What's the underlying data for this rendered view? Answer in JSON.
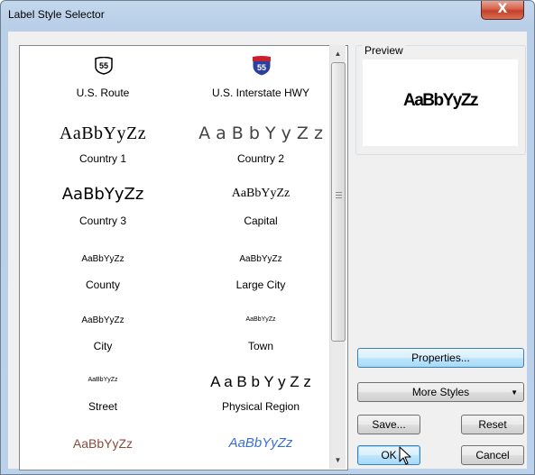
{
  "window": {
    "title": "Label Style Selector",
    "close_glyph": "X"
  },
  "styles": [
    {
      "sample": "55",
      "caption": "U.S. Route",
      "kind": "us-route-shield"
    },
    {
      "sample": "55",
      "caption": "U.S. Interstate HWY",
      "kind": "interstate-shield"
    },
    {
      "sample": "AaBbYyZz",
      "caption": "Country 1"
    },
    {
      "sample": "A a B b Y y Z z",
      "caption": "Country 2"
    },
    {
      "sample": "AaBbYyZz",
      "caption": "Country 3"
    },
    {
      "sample": "AaBbYyZz",
      "caption": "Capital"
    },
    {
      "sample": "AaBbYyZz",
      "caption": "County"
    },
    {
      "sample": "AaBbYyZz",
      "caption": "Large City"
    },
    {
      "sample": "AaBbYyZz",
      "caption": "City"
    },
    {
      "sample": "AaBbYyZz",
      "caption": "Town"
    },
    {
      "sample": "AaBbYyZz",
      "caption": "Street"
    },
    {
      "sample": "A a B b Y y Z z",
      "caption": "Physical Region"
    },
    {
      "sample": "AaBbYyZz",
      "caption": ""
    },
    {
      "sample": "AaBbYyZz",
      "caption": ""
    }
  ],
  "preview": {
    "label": "Preview",
    "text": "AaBbYyZz"
  },
  "buttons": {
    "properties": "Properties...",
    "more_styles": "More Styles",
    "save": "Save...",
    "reset": "Reset",
    "ok": "OK",
    "cancel": "Cancel"
  },
  "colors": {
    "interstate_red": "#c8202f",
    "interstate_blue": "#2a3f9e",
    "water_blue": "#3a6fd0",
    "brown_sample": "#8b4a3a"
  }
}
